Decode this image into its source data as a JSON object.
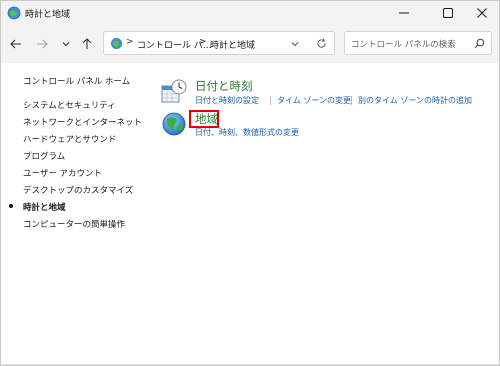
{
  "window": {
    "title": "時計と地域",
    "controls": [
      "minimize-icon",
      "maximize-icon",
      "close-icon"
    ]
  },
  "nav": {
    "back_icon": "arrow-left-icon",
    "forward_icon": "arrow-right-icon",
    "recent_icon": "chevron-down-icon",
    "up_icon": "arrow-up-icon"
  },
  "address": {
    "crumbs": [
      "コントロール パ...",
      "時計と地域"
    ],
    "separator": ">",
    "dropdown_icon": "chevron-down-icon",
    "refresh_icon": "refresh-icon"
  },
  "search": {
    "placeholder": "コントロール パネルの検索",
    "icon": "search-icon"
  },
  "sidebar": {
    "items": [
      {
        "label": "コントロール パネル ホーム",
        "current": false
      },
      {
        "label": "システムとセキュリティ",
        "current": false
      },
      {
        "label": "ネットワークとインターネット",
        "current": false
      },
      {
        "label": "ハードウェアとサウンド",
        "current": false
      },
      {
        "label": "プログラム",
        "current": false
      },
      {
        "label": "ユーザー アカウント",
        "current": false
      },
      {
        "label": "デスクトップのカスタマイズ",
        "current": false
      },
      {
        "label": "時計と地域",
        "current": true
      },
      {
        "label": "コンピューターの簡単操作",
        "current": false
      }
    ]
  },
  "main": {
    "categories": [
      {
        "title": "日付と時刻",
        "icon": "calendar-clock-icon",
        "links": [
          "日付と時刻の設定",
          "タイム ゾーンの変更",
          "別のタイム ゾーンの時計の追加"
        ]
      },
      {
        "title": "地域",
        "icon": "globe-icon",
        "highlighted": true,
        "links": [
          "日付、時刻、数値形式の変更"
        ]
      }
    ]
  },
  "colors": {
    "category_title": "#2e7d32",
    "link": "#1a5fb4",
    "highlight_border": "#e30000",
    "chrome_bg": "#f3f3f3"
  }
}
